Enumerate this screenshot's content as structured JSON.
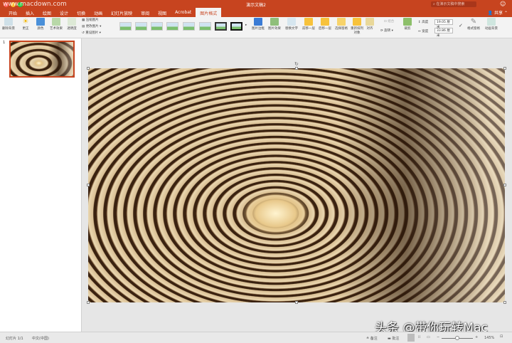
{
  "window": {
    "title": "演示文稿2",
    "watermark_top": "www.macdown.com",
    "search_placeholder": "在演示文稿中搜索",
    "share": "共享"
  },
  "tabs": [
    "开始",
    "插入",
    "绘图",
    "设计",
    "切换",
    "动画",
    "幻灯片放映",
    "审阅",
    "视图",
    "Acrobat",
    "图片格式"
  ],
  "active_tab": "图片格式",
  "ribbon": {
    "remove_bg": "删除背景",
    "corrections": "更正",
    "color": "颜色",
    "artistic": "艺术效果",
    "transparency": "透明度",
    "compress": "压缩图片",
    "change": "更改图片",
    "reset": "重设图片",
    "border": "图片边框",
    "effects": "图片效果",
    "alt_text": "替换文字",
    "forward": "前移一层",
    "backward": "后移一层",
    "selection_pane": "选择窗格",
    "reorder": "重新排列对象",
    "align": "对齐",
    "group": "组合",
    "rotate": "旋转",
    "crop": "裁剪",
    "height_label": "高度",
    "height_value": "19.05 厘米",
    "width_label": "宽度",
    "width_value": "33.86 厘米",
    "format_pane": "格式窗格",
    "anim_bg": "动画背景"
  },
  "thumbnails": {
    "number": "1"
  },
  "status": {
    "slide": "幻灯片 1/1",
    "language": "中文(中国)",
    "notes": "备注",
    "comments": "批注",
    "zoom": "145%"
  },
  "watermark": "头条 @带你玩转Mac",
  "colors": {
    "accent": "#c7441f"
  }
}
